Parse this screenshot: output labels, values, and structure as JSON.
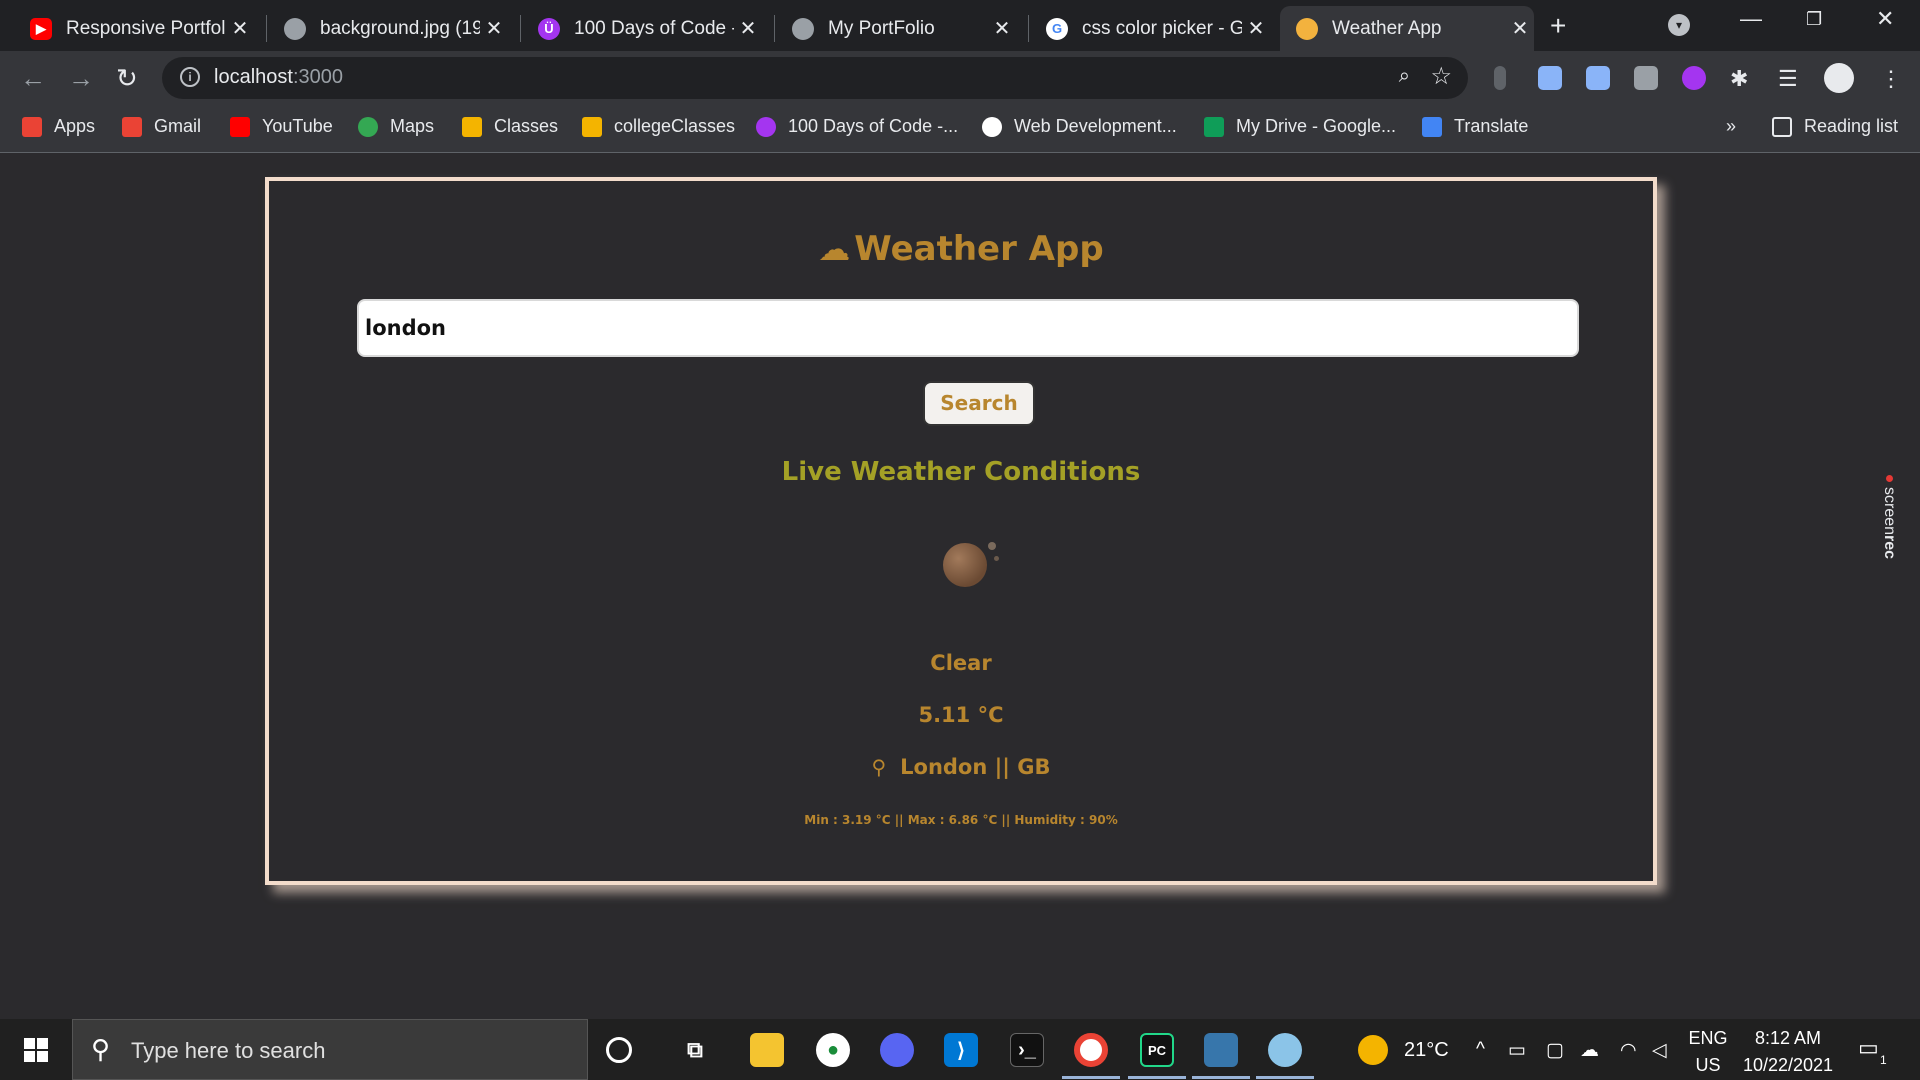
{
  "browser": {
    "tabs": [
      {
        "title": "Responsive Portfolio",
        "icon": "youtube-icon",
        "color": "#ff0000"
      },
      {
        "title": "background.jpg (19",
        "icon": "globe-icon",
        "color": "#9aa0a6"
      },
      {
        "title": "100 Days of Code -",
        "icon": "udemy-icon",
        "color": "#a435f0"
      },
      {
        "title": "My PortFolio",
        "icon": "globe-icon",
        "color": "#9aa0a6"
      },
      {
        "title": "css color picker - G",
        "icon": "google-icon",
        "color": "#4285f4"
      },
      {
        "title": "Weather App",
        "icon": "weather-icon",
        "color": "#f3b23e",
        "active": true
      }
    ],
    "url_host": "localhost",
    "url_port": ":3000",
    "bookmarks": [
      {
        "label": "Apps",
        "icon": "apps-icon",
        "color": "#ea4335"
      },
      {
        "label": "Gmail",
        "icon": "gmail-icon",
        "color": "#ea4335"
      },
      {
        "label": "YouTube",
        "icon": "youtube-icon",
        "color": "#ff0000"
      },
      {
        "label": "Maps",
        "icon": "maps-icon",
        "color": "#34a853"
      },
      {
        "label": "Classes",
        "icon": "classroom-icon",
        "color": "#f4b400"
      },
      {
        "label": "collegeClasses",
        "icon": "classroom-icon",
        "color": "#f4b400"
      },
      {
        "label": "100 Days of Code -...",
        "icon": "udemy-icon",
        "color": "#a435f0"
      },
      {
        "label": "Web Development...",
        "icon": "udemy-icon",
        "color": "#ffffff"
      },
      {
        "label": "My Drive - Google...",
        "icon": "drive-icon",
        "color": "#0f9d58"
      },
      {
        "label": "Translate",
        "icon": "translate-icon",
        "color": "#4285f4"
      }
    ],
    "more_bookmarks": "»",
    "reading_list": "Reading list"
  },
  "app": {
    "title": "Weather App",
    "search_value": "london",
    "search_button": "Search",
    "heading": "Live Weather Conditions",
    "condition": "Clear",
    "temperature": "5.11 °C",
    "location": "London || GB",
    "details": "Min : 3.19 °C || Max : 6.86 °C || Humidity : 90%",
    "accent_color": "#b8862e",
    "heading_color": "#a4a126"
  },
  "overlay": {
    "screenrec_label_a": "screen",
    "screenrec_label_b": "rec"
  },
  "taskbar": {
    "search_placeholder": "Type here to search",
    "weather_temp": "21°C",
    "language": "ENG",
    "region": "US",
    "time": "8:12 AM",
    "date": "10/22/2021",
    "notification_count": "1"
  }
}
